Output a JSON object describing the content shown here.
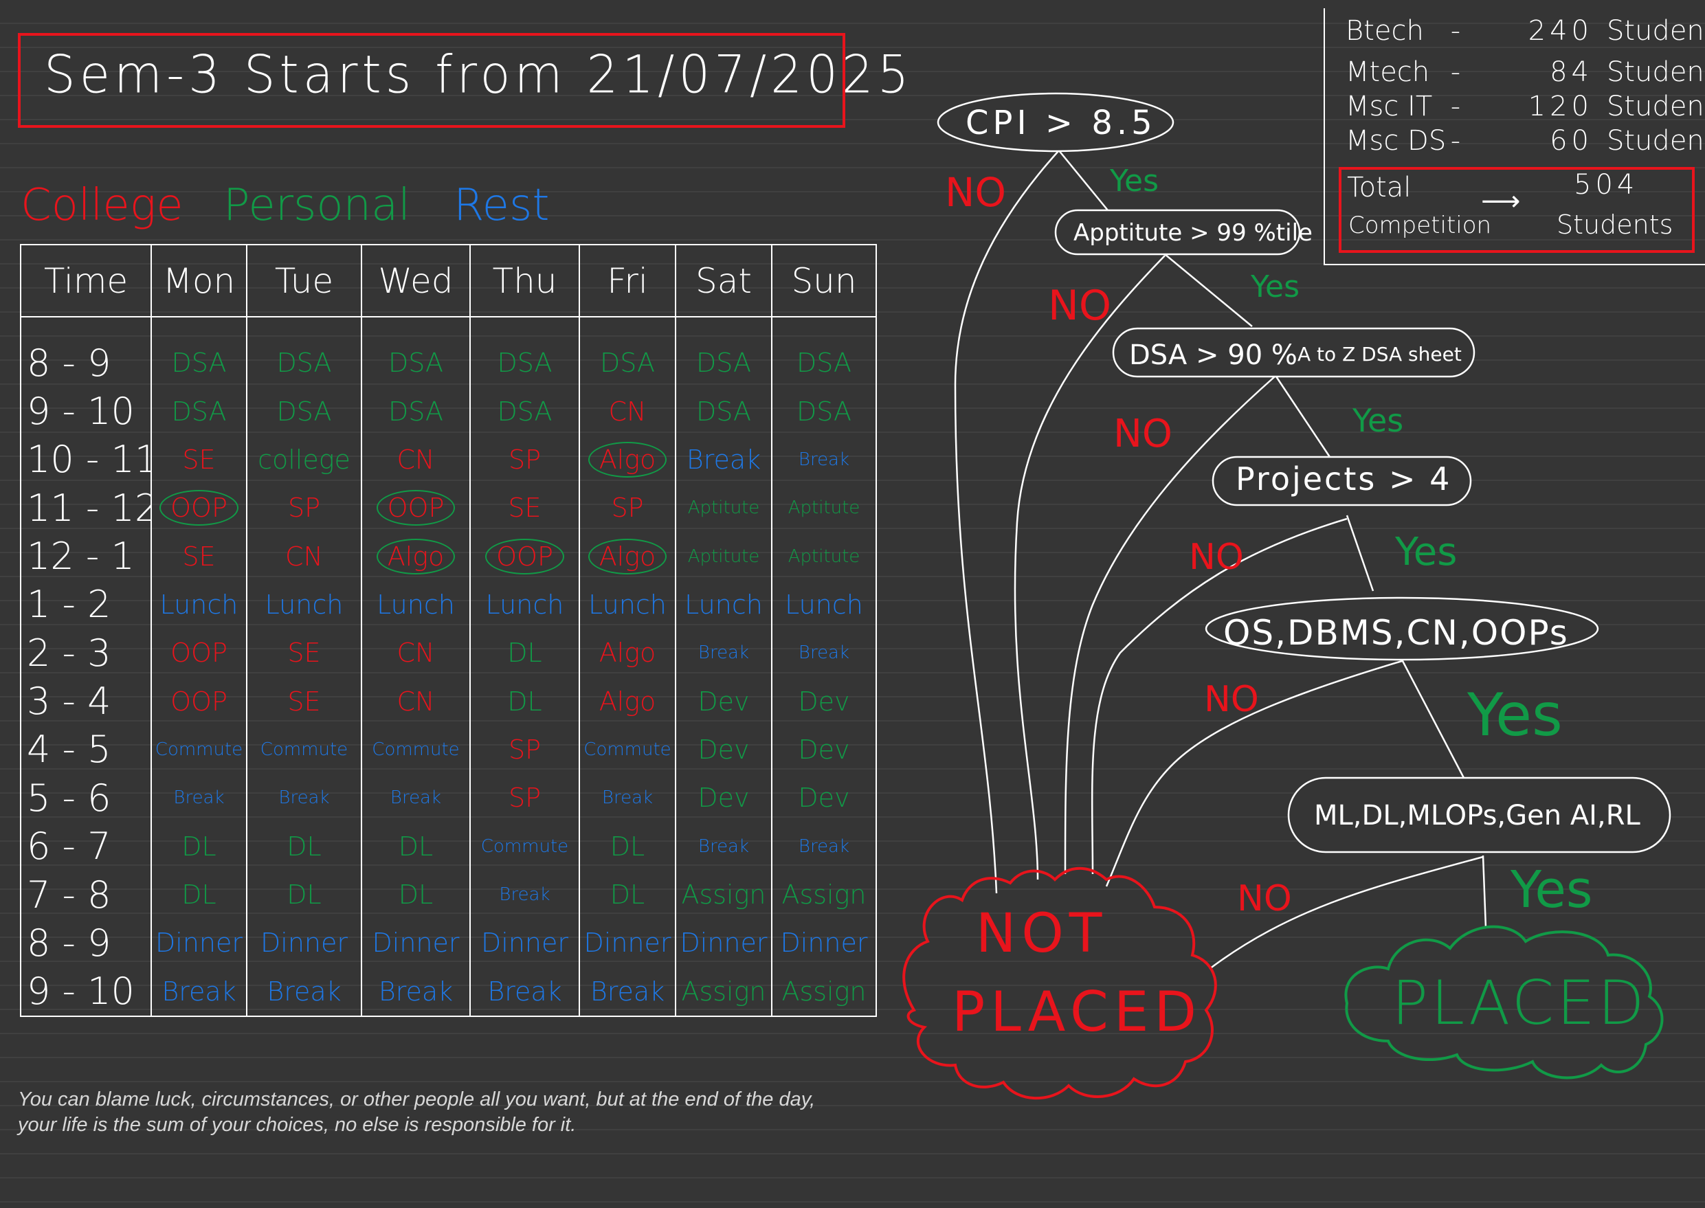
{
  "title": "Sem-3 Starts from 21/07/2025",
  "legend": {
    "college": "College",
    "personal": "Personal",
    "rest": "Rest"
  },
  "colors": {
    "college": "#e8141c",
    "personal": "#119a47",
    "rest": "#1e78e6",
    "background": "#353535"
  },
  "timetable": {
    "headers": [
      "Time",
      "Mon",
      "Tue",
      "Wed",
      "Thu",
      "Fri",
      "Sat",
      "Sun"
    ],
    "rows": [
      {
        "time": "8 - 9",
        "cells": [
          {
            "t": "DSA",
            "c": "green"
          },
          {
            "t": "DSA",
            "c": "green"
          },
          {
            "t": "DSA",
            "c": "green"
          },
          {
            "t": "DSA",
            "c": "green"
          },
          {
            "t": "DSA",
            "c": "green"
          },
          {
            "t": "DSA",
            "c": "green"
          },
          {
            "t": "DSA",
            "c": "green"
          }
        ]
      },
      {
        "time": "9 - 10",
        "cells": [
          {
            "t": "DSA",
            "c": "green"
          },
          {
            "t": "DSA",
            "c": "green"
          },
          {
            "t": "DSA",
            "c": "green"
          },
          {
            "t": "DSA",
            "c": "green"
          },
          {
            "t": "CN",
            "c": "red"
          },
          {
            "t": "DSA",
            "c": "green"
          },
          {
            "t": "DSA",
            "c": "green"
          }
        ]
      },
      {
        "time": "10 - 11",
        "cells": [
          {
            "t": "SE",
            "c": "red"
          },
          {
            "t": "college",
            "c": "green"
          },
          {
            "t": "CN",
            "c": "red"
          },
          {
            "t": "SP",
            "c": "red"
          },
          {
            "t": "Algo",
            "c": "red",
            "circle": "green"
          },
          {
            "t": "Break",
            "c": "blue"
          },
          {
            "t": "Break",
            "c": "blue",
            "small": true
          }
        ]
      },
      {
        "time": "11 - 12",
        "cells": [
          {
            "t": "OOP",
            "c": "red",
            "circle": "green"
          },
          {
            "t": "SP",
            "c": "red"
          },
          {
            "t": "OOP",
            "c": "red",
            "circle": "green"
          },
          {
            "t": "SE",
            "c": "red"
          },
          {
            "t": "SP",
            "c": "red"
          },
          {
            "t": "Aptitute",
            "c": "green",
            "small": true
          },
          {
            "t": "Aptitute",
            "c": "green",
            "small": true
          }
        ]
      },
      {
        "time": "12 - 1",
        "cells": [
          {
            "t": "SE",
            "c": "red"
          },
          {
            "t": "CN",
            "c": "red"
          },
          {
            "t": "Algo",
            "c": "red",
            "circle": "green"
          },
          {
            "t": "OOP",
            "c": "red",
            "circle": "green"
          },
          {
            "t": "Algo",
            "c": "red",
            "circle": "green"
          },
          {
            "t": "Aptitute",
            "c": "green",
            "small": true
          },
          {
            "t": "Aptitute",
            "c": "green",
            "small": true
          }
        ]
      },
      {
        "time": "1 - 2",
        "cells": [
          {
            "t": "Lunch",
            "c": "blue"
          },
          {
            "t": "Lunch",
            "c": "blue"
          },
          {
            "t": "Lunch",
            "c": "blue"
          },
          {
            "t": "Lunch",
            "c": "blue"
          },
          {
            "t": "Lunch",
            "c": "blue"
          },
          {
            "t": "Lunch",
            "c": "blue"
          },
          {
            "t": "Lunch",
            "c": "blue"
          }
        ]
      },
      {
        "time": "2 - 3",
        "cells": [
          {
            "t": "OOP",
            "c": "red"
          },
          {
            "t": "SE",
            "c": "red"
          },
          {
            "t": "CN",
            "c": "red"
          },
          {
            "t": "DL",
            "c": "green"
          },
          {
            "t": "Algo",
            "c": "red"
          },
          {
            "t": "Break",
            "c": "blue",
            "small": true
          },
          {
            "t": "Break",
            "c": "blue",
            "small": true
          }
        ]
      },
      {
        "time": "3 - 4",
        "cells": [
          {
            "t": "OOP",
            "c": "red"
          },
          {
            "t": "SE",
            "c": "red"
          },
          {
            "t": "CN",
            "c": "red"
          },
          {
            "t": "DL",
            "c": "green"
          },
          {
            "t": "Algo",
            "c": "red"
          },
          {
            "t": "Dev",
            "c": "green"
          },
          {
            "t": "Dev",
            "c": "green"
          }
        ]
      },
      {
        "time": "4 - 5",
        "cells": [
          {
            "t": "Commute",
            "c": "blue",
            "small": true
          },
          {
            "t": "Commute",
            "c": "blue",
            "small": true
          },
          {
            "t": "Commute",
            "c": "blue",
            "small": true
          },
          {
            "t": "SP",
            "c": "red"
          },
          {
            "t": "Commute",
            "c": "blue",
            "small": true
          },
          {
            "t": "Dev",
            "c": "green"
          },
          {
            "t": "Dev",
            "c": "green"
          }
        ]
      },
      {
        "time": "5 - 6",
        "cells": [
          {
            "t": "Break",
            "c": "blue",
            "small": true
          },
          {
            "t": "Break",
            "c": "blue",
            "small": true
          },
          {
            "t": "Break",
            "c": "blue",
            "small": true
          },
          {
            "t": "SP",
            "c": "red"
          },
          {
            "t": "Break",
            "c": "blue",
            "small": true
          },
          {
            "t": "Dev",
            "c": "green"
          },
          {
            "t": "Dev",
            "c": "green"
          }
        ]
      },
      {
        "time": "6 - 7",
        "cells": [
          {
            "t": "DL",
            "c": "green"
          },
          {
            "t": "DL",
            "c": "green"
          },
          {
            "t": "DL",
            "c": "green"
          },
          {
            "t": "Commute",
            "c": "blue",
            "small": true
          },
          {
            "t": "DL",
            "c": "green"
          },
          {
            "t": "Break",
            "c": "blue",
            "small": true
          },
          {
            "t": "Break",
            "c": "blue",
            "small": true
          }
        ]
      },
      {
        "time": "7 - 8",
        "cells": [
          {
            "t": "DL",
            "c": "green"
          },
          {
            "t": "DL",
            "c": "green"
          },
          {
            "t": "DL",
            "c": "green"
          },
          {
            "t": "Break",
            "c": "blue",
            "small": true
          },
          {
            "t": "DL",
            "c": "green"
          },
          {
            "t": "Assign",
            "c": "green"
          },
          {
            "t": "Assign",
            "c": "green"
          }
        ]
      },
      {
        "time": "8 - 9",
        "cells": [
          {
            "t": "Dinner",
            "c": "blue"
          },
          {
            "t": "Dinner",
            "c": "blue"
          },
          {
            "t": "Dinner",
            "c": "blue"
          },
          {
            "t": "Dinner",
            "c": "blue"
          },
          {
            "t": "Dinner",
            "c": "blue"
          },
          {
            "t": "Dinner",
            "c": "blue"
          },
          {
            "t": "Dinner",
            "c": "blue"
          }
        ]
      },
      {
        "time": "9 - 10",
        "cells": [
          {
            "t": "Break",
            "c": "blue"
          },
          {
            "t": "Break",
            "c": "blue"
          },
          {
            "t": "Break",
            "c": "blue"
          },
          {
            "t": "Break",
            "c": "blue"
          },
          {
            "t": "Break",
            "c": "blue"
          },
          {
            "t": "Assign",
            "c": "green"
          },
          {
            "t": "Assign",
            "c": "green"
          }
        ]
      }
    ]
  },
  "stats": {
    "rows": [
      {
        "program": "Btech",
        "count": "240",
        "unit": "Students"
      },
      {
        "program": "Mtech",
        "count": "84",
        "unit": "Students"
      },
      {
        "program": "Msc IT",
        "count": "120",
        "unit": "Students"
      },
      {
        "program": "Msc DS",
        "count": "60",
        "unit": "Students"
      }
    ],
    "total_label": "Total",
    "competition_label": "Competition",
    "total_count": "504",
    "total_unit": "Students"
  },
  "flowchart": {
    "nodes": {
      "cpi": "CPI > 8.5",
      "aptitude": "Apptitute > 99 %tile",
      "dsa": "DSA > 90 %",
      "dsa_note": "A to Z DSA sheet",
      "projects": "Projects > 4",
      "core": "OS,DBMS,CN,OOPs",
      "ml": "ML,DL,MLOPs,Gen AI,RL"
    },
    "yes_label": "Yes",
    "no_label": "NO",
    "outcomes": {
      "not_placed_line1": "NOT",
      "not_placed_line2": "PLACED",
      "placed": "PLACED"
    }
  },
  "quote": {
    "line1": "You can blame luck, circumstances, or other people all you want, but at the end of the day,",
    "line2": "your life is the sum of your choices, no else is responsible  for it."
  }
}
